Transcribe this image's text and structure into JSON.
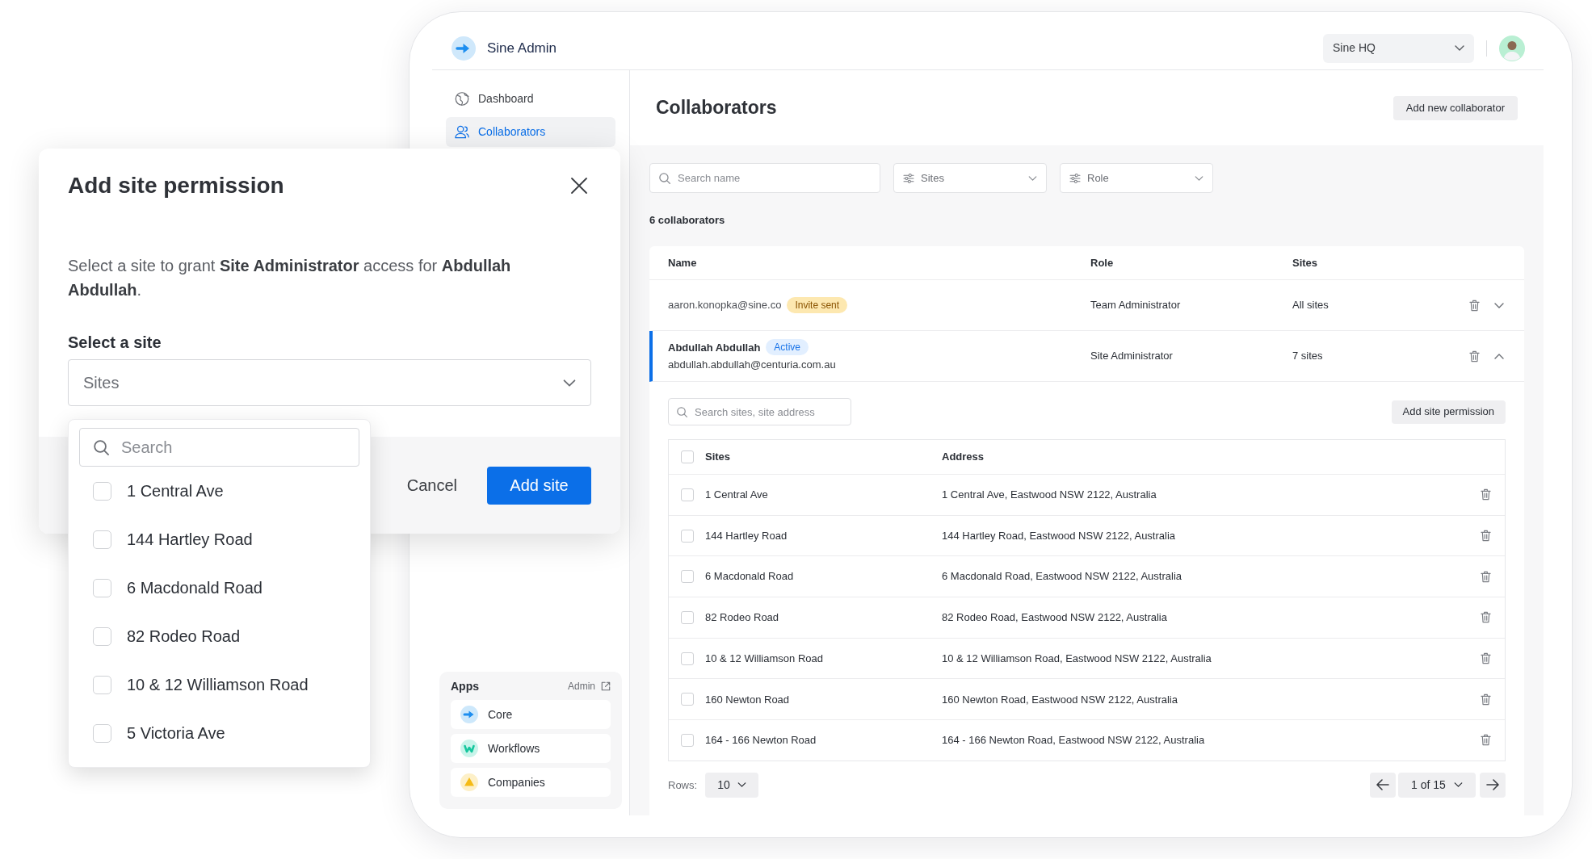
{
  "header": {
    "app_name": "Sine Admin",
    "org_select": {
      "value": "Sine HQ"
    }
  },
  "sidebar": {
    "items": [
      {
        "label": "Dashboard",
        "selected": false
      },
      {
        "label": "Collaborators",
        "selected": true
      }
    ],
    "apps": {
      "title": "Apps",
      "link": "Admin",
      "items": [
        {
          "label": "Core"
        },
        {
          "label": "Workflows"
        },
        {
          "label": "Companies"
        }
      ]
    }
  },
  "main": {
    "title": "Collaborators",
    "action": "Add new collaborator",
    "filters": {
      "search": {
        "placeholder": "Search name"
      },
      "selects": [
        {
          "label": "Sites"
        },
        {
          "label": "Role"
        }
      ]
    },
    "count": "6 collaborators",
    "table": {
      "columns": [
        "Name",
        "Role",
        "Sites"
      ],
      "rows": [
        {
          "email": "aaron.konopka@sine.co",
          "badge": {
            "label": "Invite sent",
            "kind": "invited"
          },
          "role": "Team Administrator",
          "sites": "All sites",
          "selected": false,
          "expanded": false
        },
        {
          "name": "Abdullah Abdullah",
          "badge": {
            "label": "Active",
            "kind": "active"
          },
          "email": "abdullah.abdullah@centuria.com.au",
          "role": "Site Administrator",
          "sites": "7 sites",
          "selected": true,
          "expanded": true,
          "details": {
            "search": {
              "placeholder": "Search sites, site address"
            },
            "action": "Add site permission",
            "columns": [
              "Sites",
              "Address"
            ],
            "all_checked": false,
            "rows": [
              {
                "site": "1 Central Ave",
                "address": "1 Central Ave, Eastwood NSW 2122, Australia",
                "checked": false
              },
              {
                "site": "144 Hartley Road",
                "address": "144 Hartley Road, Eastwood NSW 2122, Australia",
                "checked": false
              },
              {
                "site": "6 Macdonald Road",
                "address": "6 Macdonald Road, Eastwood NSW 2122, Australia",
                "checked": false
              },
              {
                "site": "82 Rodeo Road",
                "address": "82 Rodeo Road, Eastwood NSW 2122, Australia",
                "checked": false
              },
              {
                "site": "10 & 12 Williamson Road",
                "address": "10 & 12 Williamson Road, Eastwood NSW 2122, Australia",
                "checked": false
              },
              {
                "site": "160 Newton Road",
                "address": "160 Newton Road, Eastwood NSW 2122, Australia",
                "checked": false
              },
              {
                "site": "164 - 166 Newton Road",
                "address": "164 - 166 Newton Road, Eastwood NSW 2122, Australia",
                "checked": false
              }
            ],
            "pagination": {
              "rows_label": "Rows:",
              "page_size": "10",
              "page": "1 of 15"
            }
          }
        }
      ]
    }
  },
  "modal": {
    "title": "Add site permission",
    "description": "Select a site to grant **Site Administrator** access for **Abdullah Abdullah**.",
    "field_label": "Select a site",
    "select": {
      "placeholder": "Sites"
    },
    "dropdown": {
      "search": {
        "placeholder": "Search"
      },
      "options": [
        {
          "label": "1 Central Ave",
          "checked": false
        },
        {
          "label": "144 Hartley Road",
          "checked": false
        },
        {
          "label": "6 Macdonald Road",
          "checked": false
        },
        {
          "label": "82 Rodeo Road",
          "checked": false
        },
        {
          "label": "10 & 12 Williamson Road",
          "checked": false
        },
        {
          "label": "5 Victoria Ave",
          "checked": false
        }
      ]
    },
    "buttons": [
      {
        "label": "Cancel",
        "kind": "secondary"
      },
      {
        "label": "Add site",
        "kind": "primary"
      }
    ]
  }
}
